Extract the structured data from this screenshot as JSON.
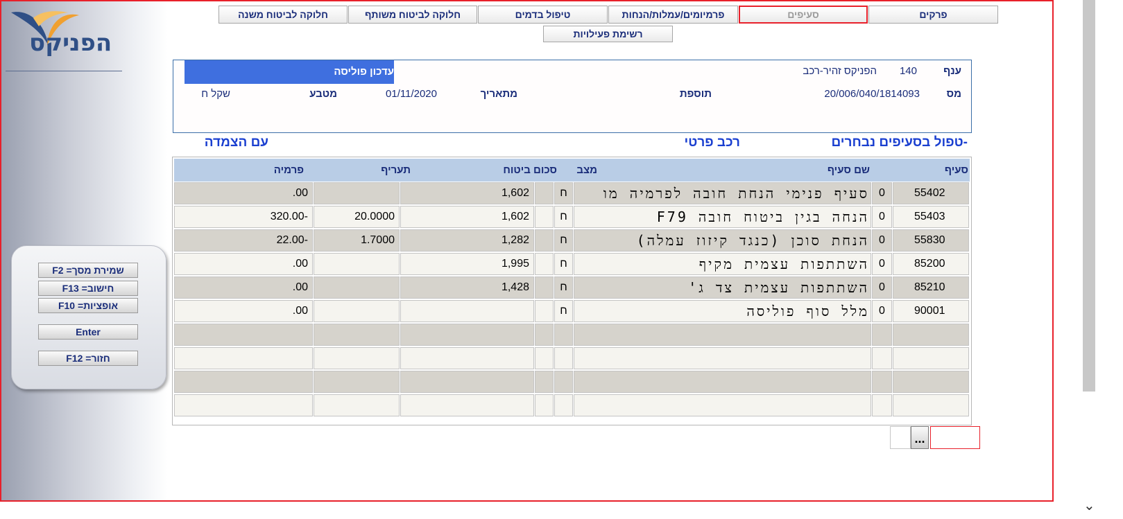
{
  "logo": {
    "text": "הפניקס"
  },
  "tabs": [
    {
      "label": "פרקים",
      "active": false
    },
    {
      "label": "סעיפים",
      "active": true
    },
    {
      "label": "פרמיומים/עמלות/הנחות",
      "active": false
    },
    {
      "label": "טיפול בדמים",
      "active": false
    },
    {
      "label": "חלוקה לביטוח משותף",
      "active": false
    },
    {
      "label": "חלוקה לביטוח משנה",
      "active": false
    },
    {
      "label": "רשימת פעילויות",
      "active": false
    }
  ],
  "info": {
    "branch_label": "ענף",
    "branch_code": "140",
    "branch_name": "הפניקס זהיר-רכב",
    "update_label": "עדכון פוליסה",
    "policy_label": "מס",
    "policy_number": "20/006/040/1814093",
    "addition_label": "תוספת",
    "from_date_label": "מתאריך",
    "from_date": "01/11/2020",
    "currency_label": "מטבע",
    "currency": "שקל ח"
  },
  "section": {
    "title": "-טפול בסעיפים נבחרים",
    "subtitle": "רכב פרטי",
    "linkage": "עם הצמדה"
  },
  "grid": {
    "headers": {
      "clause": "סעיף",
      "clause_name": "שם סעיף",
      "status": "מצב",
      "sum_insured": "סכום ביטוח",
      "tariff": "תעריף",
      "premium": "פרמיה"
    },
    "rows": [
      {
        "code": "55402",
        "flag": "0",
        "name": "סעיף פנימי הנחת חובה לפרמיה מו",
        "status": "ח",
        "sum": "1,602",
        "tariff": "",
        "premium": ".00"
      },
      {
        "code": "55403",
        "flag": "0",
        "name": "הנחה בגין ביטוח חובה F79",
        "status": "ח",
        "sum": "1,602",
        "tariff": "20.0000",
        "premium": "320.00-"
      },
      {
        "code": "55830",
        "flag": "0",
        "name": "הנחת סוכן (כנגד קיזוז עמלה)",
        "status": "ח",
        "sum": "1,282",
        "tariff": "1.7000",
        "premium": "22.00-"
      },
      {
        "code": "85200",
        "flag": "0",
        "name": "השתתפות עצמית מקיף",
        "status": "ח",
        "sum": "1,995",
        "tariff": "",
        "premium": ".00"
      },
      {
        "code": "85210",
        "flag": "0",
        "name": "השתתפות עצמית צד ג'",
        "status": "ח",
        "sum": "1,428",
        "tariff": "",
        "premium": ".00"
      },
      {
        "code": "90001",
        "flag": "0",
        "name": "מלל סוף פוליסה",
        "status": "ח",
        "sum": "",
        "tariff": "",
        "premium": ".00"
      }
    ],
    "empty_rows": 4
  },
  "fkeys": {
    "save": "שמירת מסך= F2",
    "calc": "חישוב= F13",
    "options": "אופציות= F10",
    "enter": "Enter",
    "back": "חזור= F12"
  },
  "bottom": {
    "dots": "..."
  },
  "colors": {
    "frame_border": "#e8202a",
    "header_bg": "#b9cde6",
    "update_bar": "#3f6fdf",
    "title_blue": "#1a3fd0",
    "label_navy": "#1a2d7a"
  }
}
